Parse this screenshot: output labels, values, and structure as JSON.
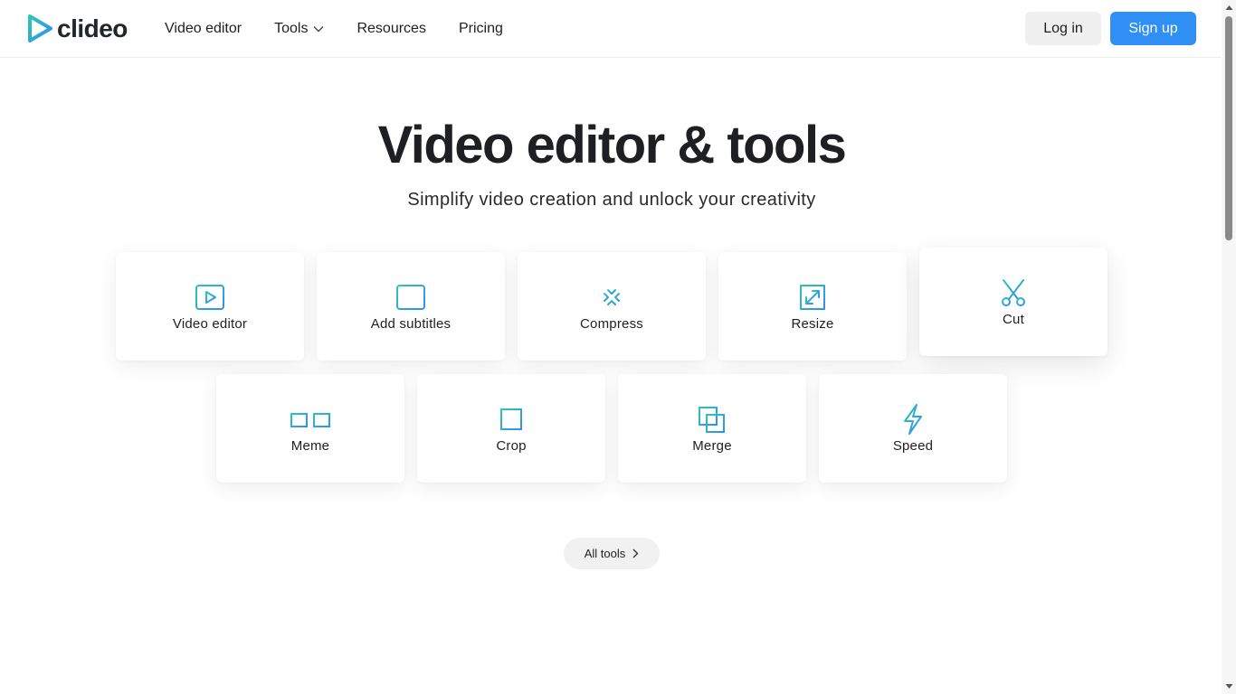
{
  "header": {
    "logo_text": "clideo",
    "nav": [
      {
        "label": "Video editor"
      },
      {
        "label": "Tools",
        "has_dropdown": true
      },
      {
        "label": "Resources"
      },
      {
        "label": "Pricing"
      }
    ],
    "login_label": "Log in",
    "signup_label": "Sign up"
  },
  "hero": {
    "title": "Video editor & tools",
    "subtitle": "Simplify video creation and unlock your creativity"
  },
  "tools": [
    {
      "label": "Video editor",
      "icon": "video-play-icon"
    },
    {
      "label": "Add subtitles",
      "icon": "subtitles-icon"
    },
    {
      "label": "Compress",
      "icon": "compress-icon"
    },
    {
      "label": "Resize",
      "icon": "resize-icon"
    },
    {
      "label": "Cut",
      "icon": "scissors-icon"
    },
    {
      "label": "Meme",
      "icon": "meme-glasses-icon"
    },
    {
      "label": "Crop",
      "icon": "crop-icon"
    },
    {
      "label": "Merge",
      "icon": "merge-icon"
    },
    {
      "label": "Speed",
      "icon": "lightning-icon"
    }
  ],
  "all_tools_label": "All tools",
  "colors": {
    "accent": "#2f8ff5",
    "icon_gradient_start": "#2ec4b6",
    "icon_gradient_end": "#2f8ff5"
  }
}
